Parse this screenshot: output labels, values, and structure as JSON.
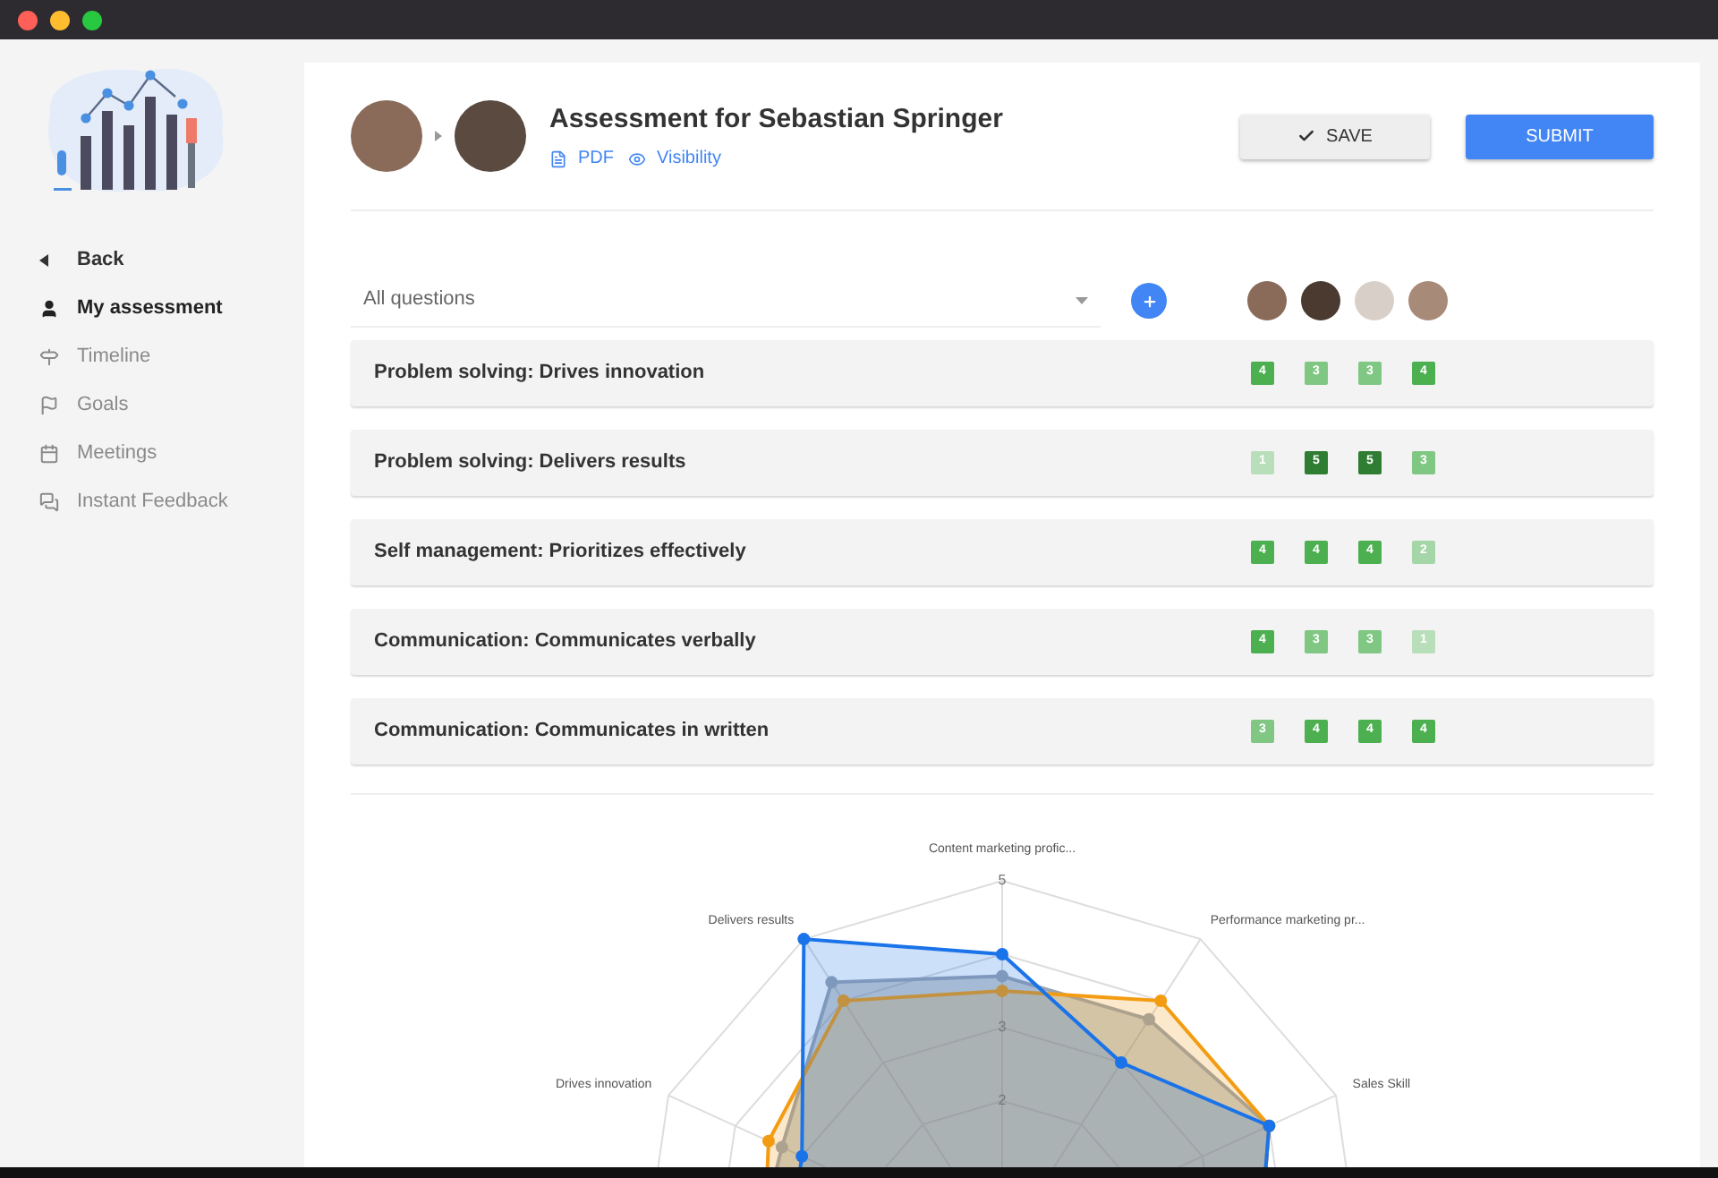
{
  "sidebar": {
    "back": "Back",
    "items": [
      {
        "label": "My assessment",
        "selected": true
      },
      {
        "label": "Timeline",
        "selected": false
      },
      {
        "label": "Goals",
        "selected": false
      },
      {
        "label": "Meetings",
        "selected": false
      },
      {
        "label": "Instant Feedback",
        "selected": false
      }
    ]
  },
  "header": {
    "title": "Assessment for Sebastian Springer",
    "links": [
      "PDF",
      "Visibility"
    ],
    "save": "SAVE",
    "submit": "SUBMIT"
  },
  "filter": {
    "value": "All questions"
  },
  "questions": [
    {
      "label": "Problem solving: Drives innovation",
      "scores": [
        {
          "text": "4",
          "color": "#4caf50"
        },
        {
          "text": "3",
          "color": "#81c784"
        },
        {
          "text": "3",
          "color": "#81c784"
        },
        {
          "text": "4",
          "color": "#4caf50"
        }
      ]
    },
    {
      "label": "Problem solving: Delivers results",
      "scores": [
        {
          "text": "1",
          "color": "#b9dfba"
        },
        {
          "text": "5",
          "color": "#2e7d32"
        },
        {
          "text": "5",
          "color": "#2e7d32"
        },
        {
          "text": "3",
          "color": "#81c784"
        }
      ]
    },
    {
      "label": "Self management: Prioritizes effectively",
      "scores": [
        {
          "text": "4",
          "color": "#4caf50"
        },
        {
          "text": "4",
          "color": "#4caf50"
        },
        {
          "text": "4",
          "color": "#4caf50"
        },
        {
          "text": "2",
          "color": "#a5d6a7"
        }
      ]
    },
    {
      "label": "Communication: Communicates verbally",
      "scores": [
        {
          "text": "4",
          "color": "#4caf50"
        },
        {
          "text": "3",
          "color": "#81c784"
        },
        {
          "text": "3",
          "color": "#81c784"
        },
        {
          "text": "1",
          "color": "#b9dfba"
        }
      ]
    },
    {
      "label": "Communication: Communicates in written",
      "scores": [
        {
          "text": "3",
          "color": "#81c784"
        },
        {
          "text": "4",
          "color": "#4caf50"
        },
        {
          "text": "4",
          "color": "#4caf50"
        },
        {
          "text": "4",
          "color": "#4caf50"
        }
      ]
    }
  ],
  "radar": {
    "axis_labels": [
      "Content marketing profic...",
      "Delivers results",
      "Performance marketing pr...",
      "Drives innovation",
      "Sales Skill"
    ],
    "tick_labels": [
      "5",
      "3",
      "2"
    ]
  }
}
